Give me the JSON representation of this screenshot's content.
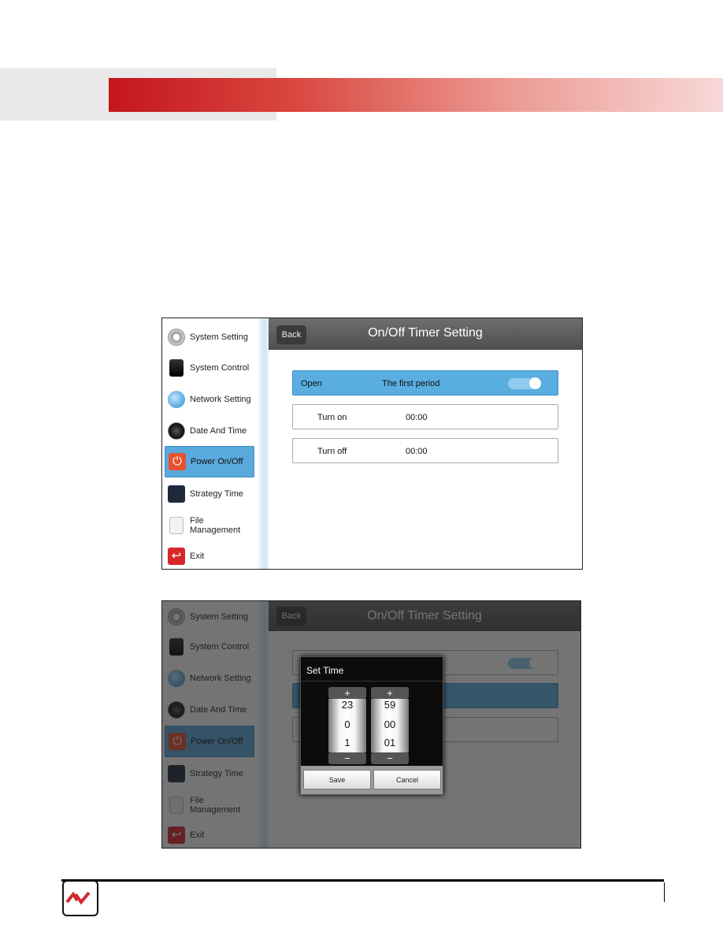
{
  "sidebar": {
    "items": [
      {
        "label": "System Setting",
        "icon": "gear-icon"
      },
      {
        "label": "System Control",
        "icon": "tablet-icon"
      },
      {
        "label": "Network Setting",
        "icon": "globe-icon"
      },
      {
        "label": "Date And Time",
        "icon": "clock-icon"
      },
      {
        "label": "Power On/Off",
        "icon": "power-icon",
        "active": true
      },
      {
        "label": "Strategy Time",
        "icon": "sliders-icon"
      },
      {
        "label": "File Management",
        "icon": "file-icon"
      },
      {
        "label": "Exit",
        "icon": "exit-icon"
      }
    ]
  },
  "header": {
    "back": "Back",
    "title": "On/Off Timer Setting"
  },
  "rows": {
    "open": {
      "label": "Open",
      "period": "The first period",
      "toggle_on": true
    },
    "turn_on": {
      "label": "Turn on",
      "value": "00:00"
    },
    "turn_off": {
      "label": "Turn off",
      "value": "00:00"
    }
  },
  "dialog": {
    "title": "Set Time",
    "plus": "+",
    "minus": "−",
    "hours": {
      "prev": "23",
      "current": "0",
      "next": "1"
    },
    "minutes": {
      "prev": "59",
      "current": "00",
      "next": "01"
    },
    "save": "Save",
    "cancel": "Cancel"
  },
  "colors": {
    "accent": "#5aaddf",
    "brand_red": "#c4161c"
  }
}
